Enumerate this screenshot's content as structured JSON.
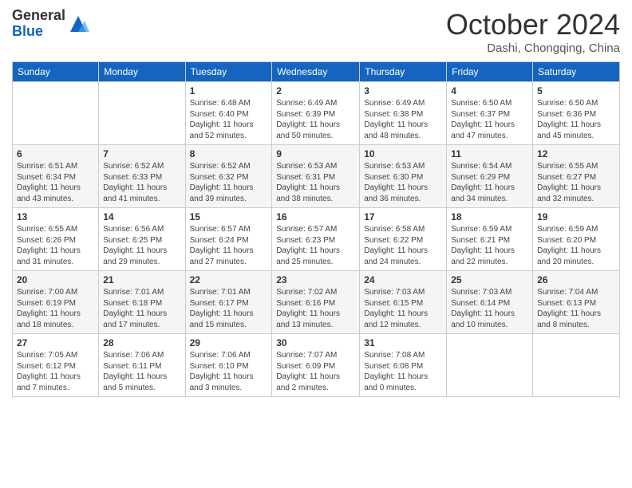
{
  "header": {
    "logo_general": "General",
    "logo_blue": "Blue",
    "month_title": "October 2024",
    "location": "Dashi, Chongqing, China"
  },
  "days_of_week": [
    "Sunday",
    "Monday",
    "Tuesday",
    "Wednesday",
    "Thursday",
    "Friday",
    "Saturday"
  ],
  "weeks": [
    [
      {
        "day": "",
        "info": ""
      },
      {
        "day": "",
        "info": ""
      },
      {
        "day": "1",
        "info": "Sunrise: 6:48 AM\nSunset: 6:40 PM\nDaylight: 11 hours and 52 minutes."
      },
      {
        "day": "2",
        "info": "Sunrise: 6:49 AM\nSunset: 6:39 PM\nDaylight: 11 hours and 50 minutes."
      },
      {
        "day": "3",
        "info": "Sunrise: 6:49 AM\nSunset: 6:38 PM\nDaylight: 11 hours and 48 minutes."
      },
      {
        "day": "4",
        "info": "Sunrise: 6:50 AM\nSunset: 6:37 PM\nDaylight: 11 hours and 47 minutes."
      },
      {
        "day": "5",
        "info": "Sunrise: 6:50 AM\nSunset: 6:36 PM\nDaylight: 11 hours and 45 minutes."
      }
    ],
    [
      {
        "day": "6",
        "info": "Sunrise: 6:51 AM\nSunset: 6:34 PM\nDaylight: 11 hours and 43 minutes."
      },
      {
        "day": "7",
        "info": "Sunrise: 6:52 AM\nSunset: 6:33 PM\nDaylight: 11 hours and 41 minutes."
      },
      {
        "day": "8",
        "info": "Sunrise: 6:52 AM\nSunset: 6:32 PM\nDaylight: 11 hours and 39 minutes."
      },
      {
        "day": "9",
        "info": "Sunrise: 6:53 AM\nSunset: 6:31 PM\nDaylight: 11 hours and 38 minutes."
      },
      {
        "day": "10",
        "info": "Sunrise: 6:53 AM\nSunset: 6:30 PM\nDaylight: 11 hours and 36 minutes."
      },
      {
        "day": "11",
        "info": "Sunrise: 6:54 AM\nSunset: 6:29 PM\nDaylight: 11 hours and 34 minutes."
      },
      {
        "day": "12",
        "info": "Sunrise: 6:55 AM\nSunset: 6:27 PM\nDaylight: 11 hours and 32 minutes."
      }
    ],
    [
      {
        "day": "13",
        "info": "Sunrise: 6:55 AM\nSunset: 6:26 PM\nDaylight: 11 hours and 31 minutes."
      },
      {
        "day": "14",
        "info": "Sunrise: 6:56 AM\nSunset: 6:25 PM\nDaylight: 11 hours and 29 minutes."
      },
      {
        "day": "15",
        "info": "Sunrise: 6:57 AM\nSunset: 6:24 PM\nDaylight: 11 hours and 27 minutes."
      },
      {
        "day": "16",
        "info": "Sunrise: 6:57 AM\nSunset: 6:23 PM\nDaylight: 11 hours and 25 minutes."
      },
      {
        "day": "17",
        "info": "Sunrise: 6:58 AM\nSunset: 6:22 PM\nDaylight: 11 hours and 24 minutes."
      },
      {
        "day": "18",
        "info": "Sunrise: 6:59 AM\nSunset: 6:21 PM\nDaylight: 11 hours and 22 minutes."
      },
      {
        "day": "19",
        "info": "Sunrise: 6:59 AM\nSunset: 6:20 PM\nDaylight: 11 hours and 20 minutes."
      }
    ],
    [
      {
        "day": "20",
        "info": "Sunrise: 7:00 AM\nSunset: 6:19 PM\nDaylight: 11 hours and 18 minutes."
      },
      {
        "day": "21",
        "info": "Sunrise: 7:01 AM\nSunset: 6:18 PM\nDaylight: 11 hours and 17 minutes."
      },
      {
        "day": "22",
        "info": "Sunrise: 7:01 AM\nSunset: 6:17 PM\nDaylight: 11 hours and 15 minutes."
      },
      {
        "day": "23",
        "info": "Sunrise: 7:02 AM\nSunset: 6:16 PM\nDaylight: 11 hours and 13 minutes."
      },
      {
        "day": "24",
        "info": "Sunrise: 7:03 AM\nSunset: 6:15 PM\nDaylight: 11 hours and 12 minutes."
      },
      {
        "day": "25",
        "info": "Sunrise: 7:03 AM\nSunset: 6:14 PM\nDaylight: 11 hours and 10 minutes."
      },
      {
        "day": "26",
        "info": "Sunrise: 7:04 AM\nSunset: 6:13 PM\nDaylight: 11 hours and 8 minutes."
      }
    ],
    [
      {
        "day": "27",
        "info": "Sunrise: 7:05 AM\nSunset: 6:12 PM\nDaylight: 11 hours and 7 minutes."
      },
      {
        "day": "28",
        "info": "Sunrise: 7:06 AM\nSunset: 6:11 PM\nDaylight: 11 hours and 5 minutes."
      },
      {
        "day": "29",
        "info": "Sunrise: 7:06 AM\nSunset: 6:10 PM\nDaylight: 11 hours and 3 minutes."
      },
      {
        "day": "30",
        "info": "Sunrise: 7:07 AM\nSunset: 6:09 PM\nDaylight: 11 hours and 2 minutes."
      },
      {
        "day": "31",
        "info": "Sunrise: 7:08 AM\nSunset: 6:08 PM\nDaylight: 11 hours and 0 minutes."
      },
      {
        "day": "",
        "info": ""
      },
      {
        "day": "",
        "info": ""
      }
    ]
  ]
}
